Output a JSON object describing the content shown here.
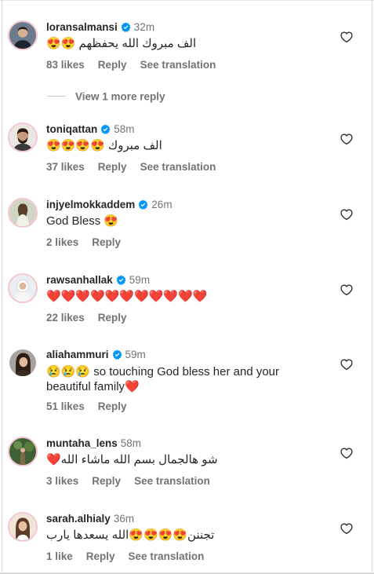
{
  "comments": [
    {
      "username": "loransalmansi",
      "verified": true,
      "time": "32m",
      "text": "الف مبروك الله يحفظهم 😍😍",
      "likes": "83 likes",
      "reply": "Reply",
      "translation": "See translation"
    },
    {
      "username": "toniqattan",
      "verified": true,
      "time": "58m",
      "text": "الف مبروك 😍😍😍😍",
      "likes": "37 likes",
      "reply": "Reply",
      "translation": "See translation"
    },
    {
      "username": "injyelmokkaddem",
      "verified": true,
      "time": "26m",
      "text": "God Bless 😍",
      "likes": "2 likes",
      "reply": "Reply"
    },
    {
      "username": "rawsanhallak",
      "verified": true,
      "time": "59m",
      "text": "❤️❤️❤️❤️❤️❤️❤️❤️❤️❤️❤️",
      "likes": "22 likes",
      "reply": "Reply"
    },
    {
      "username": "aliahammuri",
      "verified": true,
      "time": "59m",
      "text": "😢😢😢 so touching God bless her and your beautiful family❤️",
      "likes": "51 likes",
      "reply": "Reply"
    },
    {
      "username": "muntaha_lens",
      "verified": false,
      "time": "58m",
      "text": "شو هالجمال بسم الله ماشاء الله❤️",
      "likes": "3 likes",
      "reply": "Reply",
      "translation": "See translation"
    },
    {
      "username": "sarah.alhialy",
      "verified": false,
      "time": "36m",
      "text": "تجننن😍😍😍😍الله يسعدها يارب",
      "likes": "1 like",
      "reply": "Reply",
      "translation": "See translation"
    }
  ],
  "view_more_replies": "View 1 more reply",
  "colors": {
    "verified_blue": "#0095f6",
    "muted_text": "#737373",
    "primary_text": "#262626",
    "divider": "#dbdbdb"
  },
  "icons": {
    "like": "heart-outline-icon",
    "verified": "verified-badge-icon"
  }
}
